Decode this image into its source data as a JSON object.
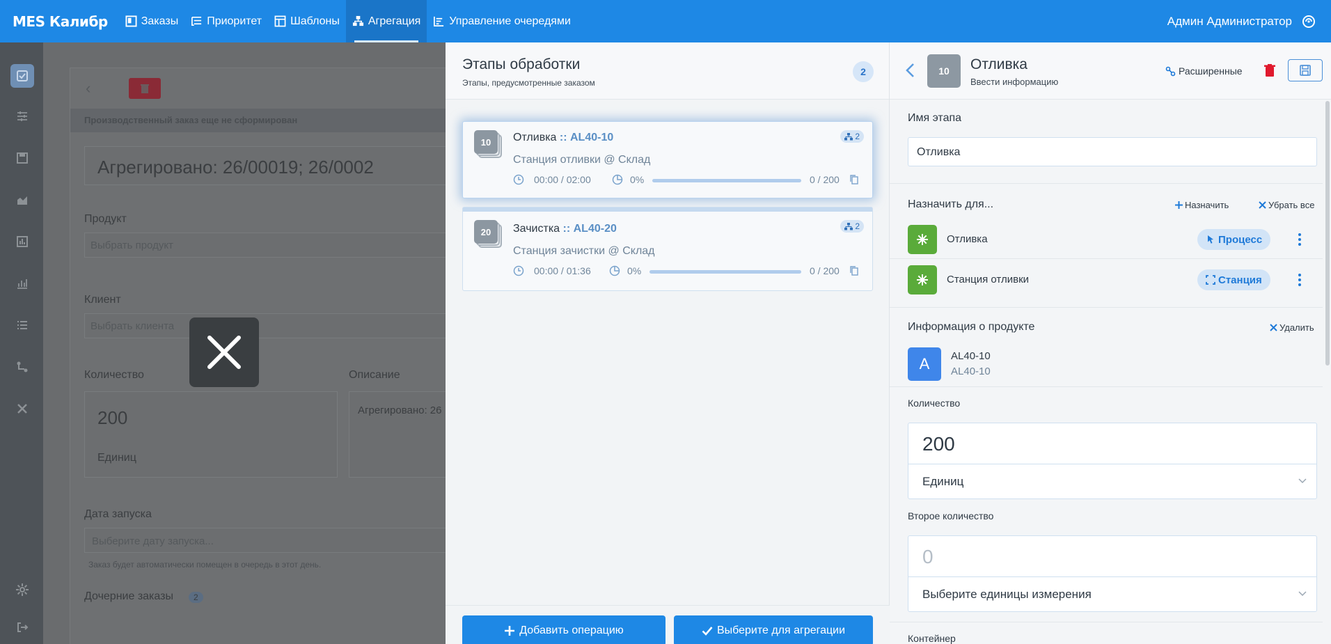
{
  "topbar": {
    "brand": "MES Калибр",
    "nav": [
      {
        "label": "Заказы",
        "icon": "orders-icon"
      },
      {
        "label": "Приоритет",
        "icon": "priority-icon"
      },
      {
        "label": "Шаблоны",
        "icon": "templates-icon"
      },
      {
        "label": "Агрегация",
        "icon": "aggregation-icon",
        "active": true
      },
      {
        "label": "Управление очередями",
        "icon": "queue-icon"
      }
    ],
    "user": "Админ Администратор"
  },
  "background": {
    "banner": "Производственный заказ еще не сформирован",
    "title_value": "Агрегировано: 26/00019; 26/0002",
    "product_label": "Продукт",
    "product_placeholder": "Выбрать продукт",
    "client_label": "Клиент",
    "client_placeholder": "Выбрать клиента",
    "qty_label": "Количество",
    "qty_value": "200",
    "qty_unit": "Единиц",
    "desc_label": "Описание",
    "desc_value": "Агрегировано: 26",
    "launch_label": "Дата запуска",
    "launch_placeholder": "Выберите дату запуска...",
    "launch_hint": "Заказ будет автоматически помещен в очередь в этот день.",
    "child_label": "Дочерние заказы",
    "child_count": "2"
  },
  "stages": {
    "title": "Этапы обработки",
    "subtitle": "Этапы, предусмотренные заказом",
    "count": "2",
    "items": [
      {
        "num": "10",
        "name": "Отливка",
        "sep": " :: ",
        "code": "AL40-10",
        "station": "Станция отливки @ Склад",
        "time": "00:00 / 02:00",
        "pct": "0%",
        "progress": "0 / 200",
        "links": "2",
        "progress_fraction": 0
      },
      {
        "num": "20",
        "name": "Зачистка",
        "sep": " :: ",
        "code": "AL40-20",
        "station": "Станция зачистки @ Склад",
        "time": "00:00 / 01:36",
        "pct": "0%",
        "progress": "0 / 200",
        "links": "2",
        "progress_fraction": 0
      }
    ],
    "add_button": "Добавить операцию",
    "aggregate_button": "Выберите для агрегации"
  },
  "detail": {
    "num": "10",
    "title": "Отливка",
    "subtitle": "Ввести информацию",
    "advanced": "Расширенные",
    "stage_name_label": "Имя этапа",
    "stage_name_value": "Отливка",
    "assign_label": "Назначить для...",
    "assign_add": "Назначить",
    "assign_remove": "Убрать все",
    "assignments": [
      {
        "label": "Отливка",
        "pill": "Процесс"
      },
      {
        "label": "Станция отливки",
        "pill": "Станция"
      }
    ],
    "product_info_label": "Информация о продукте",
    "product_delete": "Удалить",
    "product_avatar": "A",
    "product_name": "AL40-10",
    "product_code": "AL40-10",
    "qty_label": "Количество",
    "qty_value": "200",
    "qty_unit": "Единиц",
    "qty2_label": "Второе количество",
    "qty2_placeholder": "0",
    "qty2_unit_placeholder": "Выберите единицы измерения",
    "container_label": "Контейнер"
  },
  "colors": {
    "accent": "#1e88e5",
    "danger": "#e0192d",
    "assign_green": "#5aab3a"
  }
}
